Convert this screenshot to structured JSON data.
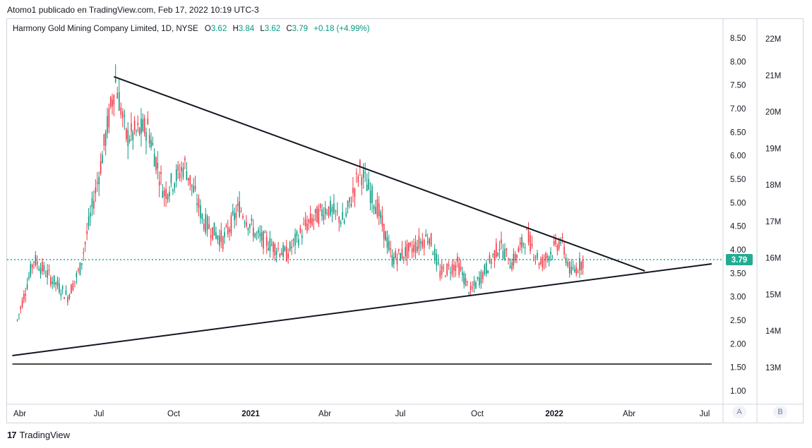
{
  "header": {
    "text": "Atomo1 publicado en TradingView.com, Feb 17, 2022 10:19 UTC-3"
  },
  "legend": {
    "symbol": "Harmony Gold Mining Company Limited, 1D, NYSE",
    "o_label": "O",
    "o_value": "3.62",
    "h_label": "H",
    "h_value": "3.84",
    "l_label": "L",
    "l_value": "3.62",
    "c_label": "C",
    "c_value": "3.79",
    "change": "+0.18 (+4.99%)"
  },
  "footer": {
    "brand": "TradingView",
    "logo_mark": "17"
  },
  "scale_buttons": {
    "a": "A",
    "b": "B"
  },
  "colors": {
    "up": "#089981",
    "down": "#f23645",
    "trendline": "#131722",
    "last_price": "#22ab94",
    "axis_text": "#131722",
    "volume_text": "#131722"
  },
  "chart_data": {
    "type": "candlestick",
    "title": "Harmony Gold Mining Company Limited, 1D, NYSE",
    "price_axis": {
      "ticks": [
        "8.50",
        "8.00",
        "7.50",
        "7.00",
        "6.50",
        "6.00",
        "5.50",
        "5.00",
        "4.50",
        "4.00",
        "3.50",
        "3.00",
        "2.50",
        "2.00",
        "1.50",
        "1.00"
      ],
      "ylim": [
        0.7,
        8.9
      ]
    },
    "volume_axis": {
      "ticks": [
        "22M",
        "21M",
        "20M",
        "19M",
        "18M",
        "17M",
        "16M",
        "15M",
        "14M",
        "13M"
      ]
    },
    "time_axis": {
      "ticks": [
        "Abr",
        "Jul",
        "Oct",
        "2021",
        "Abr",
        "Jul",
        "Oct",
        "2022",
        "Abr",
        "Jul"
      ],
      "bold": [
        "2021",
        "2022"
      ]
    },
    "last_price": {
      "value": 3.79,
      "label": "3.79"
    },
    "swing_points": [
      {
        "date": "2020-03-31",
        "price": 2.5
      },
      {
        "date": "2020-04-20",
        "price": 3.8
      },
      {
        "date": "2020-05-31",
        "price": 3.0
      },
      {
        "date": "2020-06-15",
        "price": 3.6
      },
      {
        "date": "2020-07-10",
        "price": 5.8
      },
      {
        "date": "2020-07-28",
        "price": 7.6
      },
      {
        "date": "2020-08-10",
        "price": 6.4
      },
      {
        "date": "2020-09-05",
        "price": 6.6
      },
      {
        "date": "2020-09-25",
        "price": 5.2
      },
      {
        "date": "2020-10-20",
        "price": 5.8
      },
      {
        "date": "2020-11-12",
        "price": 4.6
      },
      {
        "date": "2020-12-05",
        "price": 4.2
      },
      {
        "date": "2020-12-25",
        "price": 4.9
      },
      {
        "date": "2021-01-15",
        "price": 4.3
      },
      {
        "date": "2021-02-20",
        "price": 3.9
      },
      {
        "date": "2021-03-15",
        "price": 4.5
      },
      {
        "date": "2021-04-10",
        "price": 4.9
      },
      {
        "date": "2021-05-01",
        "price": 4.6
      },
      {
        "date": "2021-05-20",
        "price": 5.7
      },
      {
        "date": "2021-06-10",
        "price": 4.9
      },
      {
        "date": "2021-06-28",
        "price": 3.8
      },
      {
        "date": "2021-07-20",
        "price": 4.0
      },
      {
        "date": "2021-08-12",
        "price": 4.3
      },
      {
        "date": "2021-08-25",
        "price": 3.5
      },
      {
        "date": "2021-09-15",
        "price": 3.7
      },
      {
        "date": "2021-10-01",
        "price": 3.1
      },
      {
        "date": "2021-10-20",
        "price": 3.6
      },
      {
        "date": "2021-11-05",
        "price": 4.1
      },
      {
        "date": "2021-11-20",
        "price": 3.7
      },
      {
        "date": "2021-12-08",
        "price": 4.3
      },
      {
        "date": "2021-12-25",
        "price": 3.7
      },
      {
        "date": "2022-01-18",
        "price": 4.2
      },
      {
        "date": "2022-01-31",
        "price": 3.5
      },
      {
        "date": "2022-02-16",
        "price": 3.8
      }
    ],
    "trendlines": [
      {
        "name": "upper",
        "from": {
          "date": "2020-07-26",
          "price": 7.68
        },
        "to": {
          "date": "2022-04-30",
          "price": 3.55
        }
      },
      {
        "name": "lower",
        "from": {
          "date": "2020-03-25",
          "price": 1.75
        },
        "to": {
          "date": "2022-07-20",
          "price": 3.7
        }
      },
      {
        "name": "horizontal",
        "from": {
          "date": "2020-03-25",
          "price": 1.57
        },
        "to": {
          "date": "2022-07-20",
          "price": 1.57
        }
      }
    ]
  }
}
